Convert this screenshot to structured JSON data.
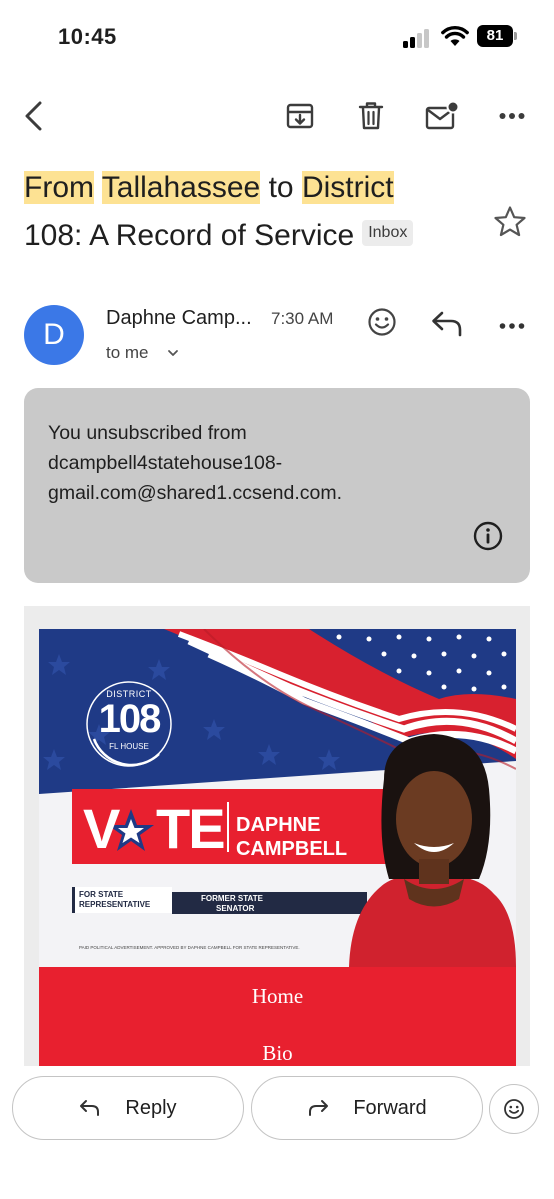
{
  "status_bar": {
    "time": "10:45",
    "battery": "81"
  },
  "subject": {
    "parts": [
      {
        "text": "From",
        "highlight": true
      },
      {
        "text": " ",
        "highlight": false
      },
      {
        "text": "Tallahassee",
        "highlight": true
      },
      {
        "text": " to ",
        "highlight": false
      },
      {
        "text": "District",
        "highlight": true
      },
      {
        "text": " 108: A Record of Service",
        "highlight": false
      }
    ],
    "label_chip": "Inbox"
  },
  "message": {
    "avatar_letter": "D",
    "sender": "Daphne Camp...",
    "time": "7:30 AM",
    "recipient": "to me"
  },
  "unsubscribe_notice": {
    "line1": "You unsubscribed from",
    "line2": "dcampbell4statehouse108-",
    "line3": "gmail.com@shared1.ccsend.com."
  },
  "banner": {
    "badge_top": "DISTRICT",
    "badge_number": "108",
    "badge_bottom": "FL HOUSE",
    "vote_prefix": "V",
    "vote_suffix": "TE",
    "candidate_first": "DAPHNE",
    "candidate_last": "CAMPBELL",
    "office_left_1": "FOR STATE",
    "office_left_2": "REPRESENTATIVE",
    "office_right_1": "FORMER STATE",
    "office_right_2": "SENATOR",
    "disclaimer": "PAID POLITICAL ADVERTISEMENT. APPROVED BY DAPHNE CAMPBELL FOR STATE REPRESENTATIVE."
  },
  "email_nav": {
    "items": [
      "Home",
      "Bio"
    ]
  },
  "actions": {
    "reply": "Reply",
    "forward": "Forward"
  },
  "colors": {
    "highlight": "#fde293",
    "avatar": "#3b78e7",
    "notice_bg": "#c9c9c9",
    "navy": "#1f3a86",
    "red": "#e8202f"
  }
}
